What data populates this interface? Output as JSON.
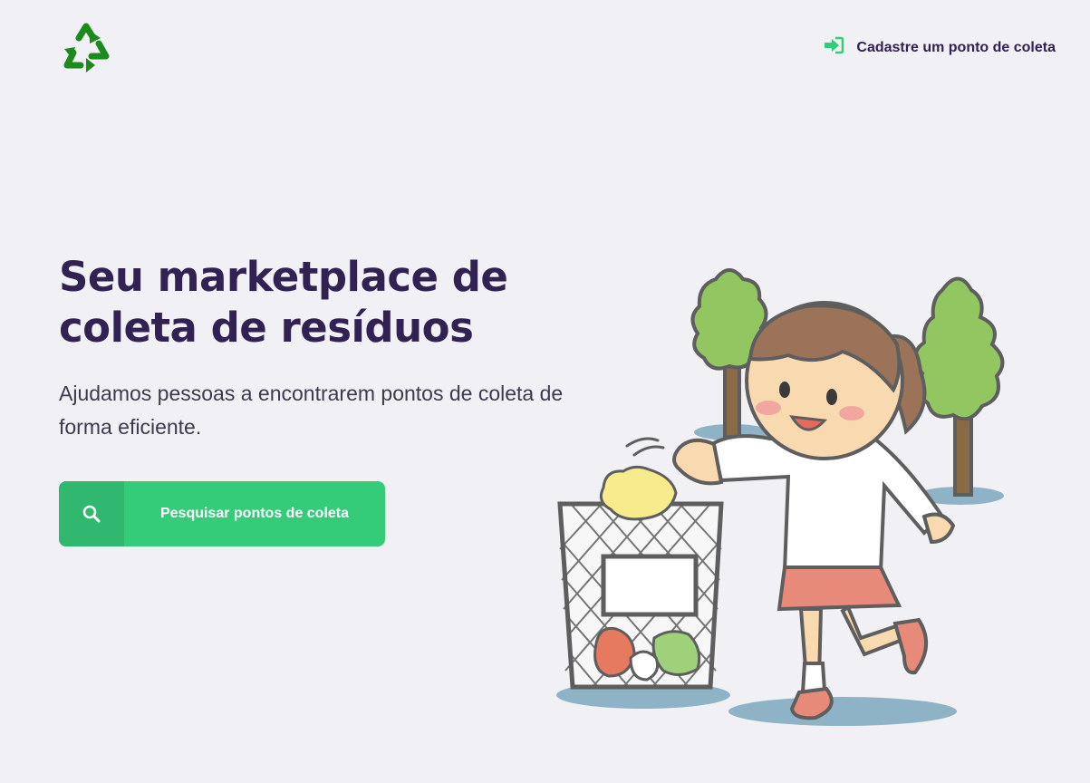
{
  "header": {
    "logo_icon": "recycle-icon",
    "register_icon": "sign-in-icon",
    "register_label": "Cadastre um ponto de coleta"
  },
  "hero": {
    "title": "Seu marketplace de coleta de resíduos",
    "subtitle": "Ajudamos pessoas a encontrarem pontos de coleta de forma eficiente.",
    "search_icon": "search-icon",
    "search_label": "Pesquisar pontos de coleta"
  },
  "colors": {
    "background": "#F0F0F5",
    "title": "#322153",
    "accent": "#34CB79",
    "accent_dark": "#2FB86E",
    "logo": "#1C8A1C"
  }
}
